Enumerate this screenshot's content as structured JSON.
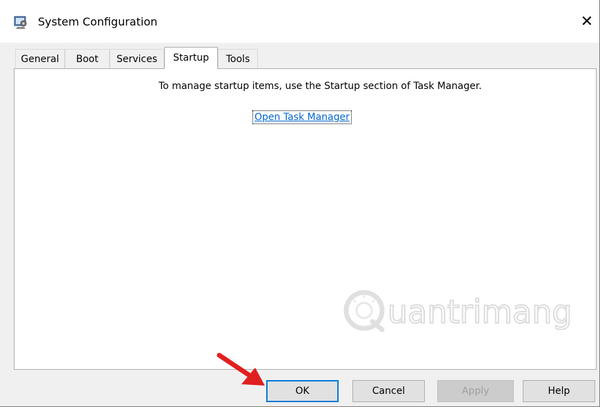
{
  "window": {
    "title": "System Configuration",
    "close_symbol": "✕"
  },
  "tabs": [
    {
      "label": "General",
      "active": false
    },
    {
      "label": "Boot",
      "active": false
    },
    {
      "label": "Services",
      "active": false
    },
    {
      "label": "Startup",
      "active": true
    },
    {
      "label": "Tools",
      "active": false
    }
  ],
  "startup": {
    "info_text": "To manage startup items, use the Startup section of Task Manager.",
    "link_text": "Open Task Manager"
  },
  "buttons": {
    "ok": "OK",
    "cancel": "Cancel",
    "apply": "Apply",
    "help": "Help"
  },
  "watermark": {
    "text": "uantrimang"
  },
  "colors": {
    "accent": "#0078d7",
    "link": "#0066cc",
    "arrow": "#e02020"
  },
  "icons": {
    "app": "msconfig-icon",
    "pointer": "red-arrow-icon"
  }
}
